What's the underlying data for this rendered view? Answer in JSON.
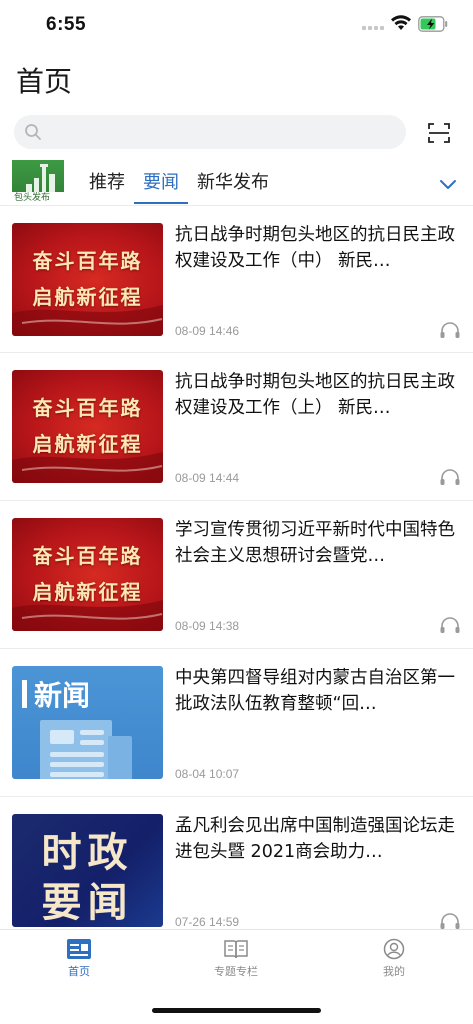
{
  "status_bar": {
    "time": "6:55"
  },
  "header": {
    "title": "首页"
  },
  "search": {
    "placeholder": "",
    "value": ""
  },
  "channel_logo": {
    "text": "包头发布"
  },
  "tabs": [
    {
      "label": "推荐",
      "active": false
    },
    {
      "label": "要闻",
      "active": true
    },
    {
      "label": "新华发布",
      "active": false
    }
  ],
  "thumbnails": {
    "red_banner": {
      "line1": "奋斗百年路",
      "line2": "启航新征程"
    },
    "news_banner": {
      "label": "新闻"
    },
    "politics_banner": {
      "line1": "时政",
      "line2": "要闻"
    }
  },
  "news": [
    {
      "title": "抗日战争时期包头地区的抗日民主政权建设及工作（中） 新民…",
      "time": "08-09 14:46",
      "thumb": "red_banner",
      "listen": true
    },
    {
      "title": "抗日战争时期包头地区的抗日民主政权建设及工作（上） 新民…",
      "time": "08-09 14:44",
      "thumb": "red_banner",
      "listen": true
    },
    {
      "title": "学习宣传贯彻习近平新时代中国特色社会主义思想研讨会暨党…",
      "time": "08-09 14:38",
      "thumb": "red_banner",
      "listen": true
    },
    {
      "title": "中央第四督导组对内蒙古自治区第一批政法队伍教育整顿“回…",
      "time": "08-04 10:07",
      "thumb": "news_banner",
      "listen": false
    },
    {
      "title": "孟凡利会见出席中国制造强国论坛走进包头暨 2021商会助力…",
      "time": "07-26 14:59",
      "thumb": "politics_banner",
      "listen": true
    }
  ],
  "bottom_nav": [
    {
      "label": "首页",
      "icon": "home-icon",
      "active": true
    },
    {
      "label": "专题专栏",
      "icon": "book-icon",
      "active": false
    },
    {
      "label": "我的",
      "icon": "profile-icon",
      "active": false
    }
  ],
  "colors": {
    "accent": "#2f6fc0",
    "time_text": "#9a9a9a",
    "banner_red": "#b8161a",
    "banner_blue": "#4b95d6",
    "banner_navy": "#1b2a6e"
  }
}
